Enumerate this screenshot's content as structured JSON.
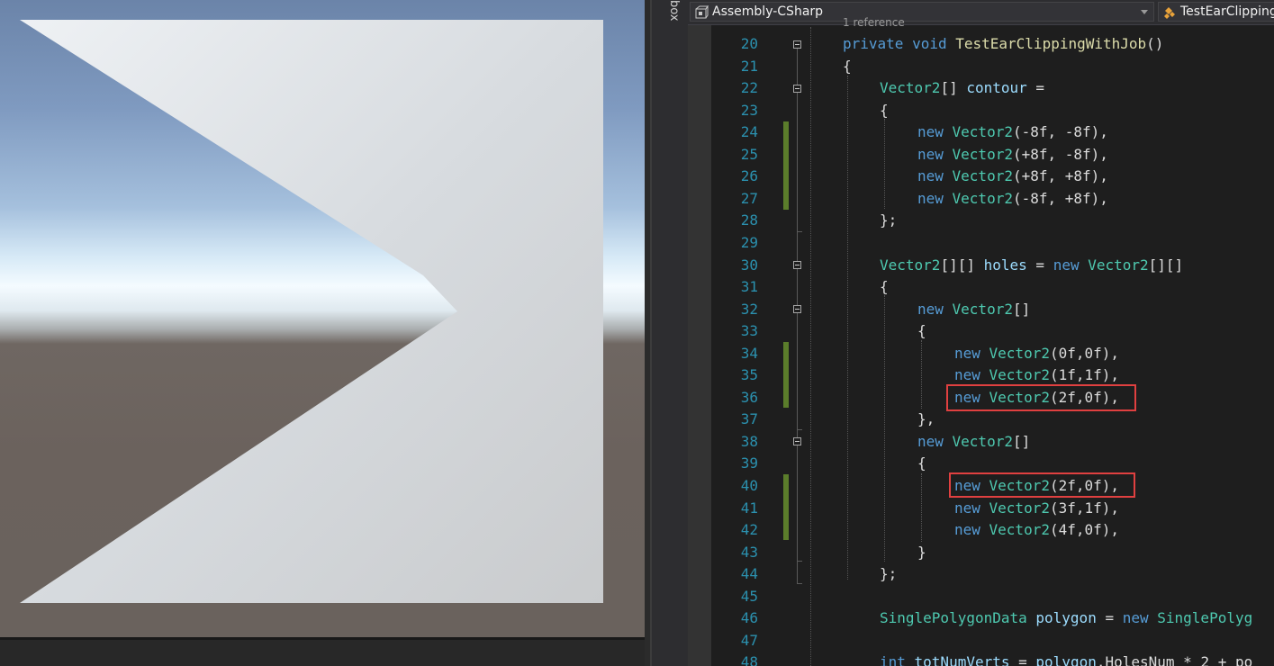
{
  "navbar": {
    "project": "Assembly-CSharp",
    "class_member": "TestEarClipping",
    "project_icon": "project-icon",
    "class_icon": "class-icon"
  },
  "toolbox": {
    "label": "box"
  },
  "codelens": "1 reference",
  "lines": [
    {
      "n": "20",
      "tokens": [
        [
          "kw",
          "private "
        ],
        [
          "kw",
          "void "
        ],
        [
          "mt",
          "TestEarClippingWithJob"
        ],
        [
          "pl",
          "()"
        ]
      ],
      "indent": 0
    },
    {
      "n": "21",
      "tokens": [
        [
          "pl",
          "{"
        ]
      ],
      "indent": 0
    },
    {
      "n": "22",
      "tokens": [
        [
          "ty",
          "Vector2"
        ],
        [
          "pl",
          "[] "
        ],
        [
          "vr",
          "contour"
        ],
        [
          "pl",
          " ="
        ]
      ],
      "indent": 1
    },
    {
      "n": "23",
      "tokens": [
        [
          "pl",
          "{"
        ]
      ],
      "indent": 1
    },
    {
      "n": "24",
      "tokens": [
        [
          "kw",
          "new "
        ],
        [
          "ty",
          "Vector2"
        ],
        [
          "pl",
          "(-8f, -8f),"
        ]
      ],
      "indent": 2
    },
    {
      "n": "25",
      "tokens": [
        [
          "kw",
          "new "
        ],
        [
          "ty",
          "Vector2"
        ],
        [
          "pl",
          "(+8f, -8f),"
        ]
      ],
      "indent": 2
    },
    {
      "n": "26",
      "tokens": [
        [
          "kw",
          "new "
        ],
        [
          "ty",
          "Vector2"
        ],
        [
          "pl",
          "(+8f, +8f),"
        ]
      ],
      "indent": 2
    },
    {
      "n": "27",
      "tokens": [
        [
          "kw",
          "new "
        ],
        [
          "ty",
          "Vector2"
        ],
        [
          "pl",
          "(-8f, +8f),"
        ]
      ],
      "indent": 2
    },
    {
      "n": "28",
      "tokens": [
        [
          "pl",
          "};"
        ]
      ],
      "indent": 1
    },
    {
      "n": "29",
      "tokens": [],
      "indent": 0
    },
    {
      "n": "30",
      "tokens": [
        [
          "ty",
          "Vector2"
        ],
        [
          "pl",
          "[][] "
        ],
        [
          "vr",
          "holes"
        ],
        [
          "pl",
          " = "
        ],
        [
          "kw",
          "new "
        ],
        [
          "ty",
          "Vector2"
        ],
        [
          "pl",
          "[][]"
        ]
      ],
      "indent": 1
    },
    {
      "n": "31",
      "tokens": [
        [
          "pl",
          "{"
        ]
      ],
      "indent": 1
    },
    {
      "n": "32",
      "tokens": [
        [
          "kw",
          "new "
        ],
        [
          "ty",
          "Vector2"
        ],
        [
          "pl",
          "[]"
        ]
      ],
      "indent": 2
    },
    {
      "n": "33",
      "tokens": [
        [
          "pl",
          "{"
        ]
      ],
      "indent": 2
    },
    {
      "n": "34",
      "tokens": [
        [
          "kw",
          "new "
        ],
        [
          "ty",
          "Vector2"
        ],
        [
          "pl",
          "(0f,0f),"
        ]
      ],
      "indent": 3
    },
    {
      "n": "35",
      "tokens": [
        [
          "kw",
          "new "
        ],
        [
          "ty",
          "Vector2"
        ],
        [
          "pl",
          "(1f,1f),"
        ]
      ],
      "indent": 3
    },
    {
      "n": "36",
      "tokens": [
        [
          "kw",
          "new "
        ],
        [
          "ty",
          "Vector2"
        ],
        [
          "pl",
          "(2f,0f),"
        ]
      ],
      "indent": 3
    },
    {
      "n": "37",
      "tokens": [
        [
          "pl",
          "},"
        ]
      ],
      "indent": 2
    },
    {
      "n": "38",
      "tokens": [
        [
          "kw",
          "new "
        ],
        [
          "ty",
          "Vector2"
        ],
        [
          "pl",
          "[]"
        ]
      ],
      "indent": 2
    },
    {
      "n": "39",
      "tokens": [
        [
          "pl",
          "{"
        ]
      ],
      "indent": 2
    },
    {
      "n": "40",
      "tokens": [
        [
          "kw",
          "new "
        ],
        [
          "ty",
          "Vector2"
        ],
        [
          "pl",
          "(2f,0f),"
        ]
      ],
      "indent": 3
    },
    {
      "n": "41",
      "tokens": [
        [
          "kw",
          "new "
        ],
        [
          "ty",
          "Vector2"
        ],
        [
          "pl",
          "(3f,1f),"
        ]
      ],
      "indent": 3
    },
    {
      "n": "42",
      "tokens": [
        [
          "kw",
          "new "
        ],
        [
          "ty",
          "Vector2"
        ],
        [
          "pl",
          "(4f,0f),"
        ]
      ],
      "indent": 3
    },
    {
      "n": "43",
      "tokens": [
        [
          "pl",
          "}"
        ]
      ],
      "indent": 2
    },
    {
      "n": "44",
      "tokens": [
        [
          "pl",
          "};"
        ]
      ],
      "indent": 1
    },
    {
      "n": "45",
      "tokens": [],
      "indent": 0
    },
    {
      "n": "46",
      "tokens": [
        [
          "ty",
          "SinglePolygonData "
        ],
        [
          "vr",
          "polygon"
        ],
        [
          "pl",
          " = "
        ],
        [
          "kw",
          "new "
        ],
        [
          "ty",
          "SinglePolyg"
        ]
      ],
      "indent": 1
    },
    {
      "n": "47",
      "tokens": [],
      "indent": 0
    },
    {
      "n": "48",
      "tokens": [
        [
          "kw",
          "int "
        ],
        [
          "vr",
          "totNumVerts"
        ],
        [
          "pl",
          " = "
        ],
        [
          "vr",
          "polygon"
        ],
        [
          "pl",
          ".HolesNum * 2 + po"
        ]
      ],
      "indent": 1
    }
  ],
  "highlighted_lines": [
    "36",
    "40"
  ],
  "changed_lines": [
    "24",
    "25",
    "26",
    "27",
    "34",
    "35",
    "36",
    "40",
    "41",
    "42"
  ],
  "colors": {
    "keyword": "#569cd6",
    "type": "#4ec9b0",
    "method": "#dcdcaa",
    "variable": "#9cdcfe",
    "line_number": "#2b91af",
    "highlight_box": "#e04040",
    "change_bar": "#5b7d2b"
  },
  "scene": {
    "description_icon": "unity-scene-view",
    "mesh_fill": "#dfe3e6"
  }
}
